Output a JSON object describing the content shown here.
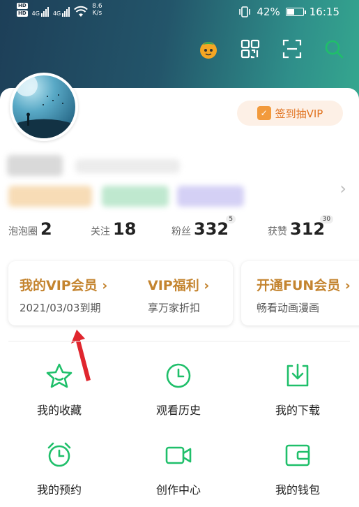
{
  "status_bar": {
    "hd1": "HD",
    "hd2": "HD",
    "sig1": "4G",
    "sig2": "4G",
    "speed": "8.6",
    "speed_unit": "K/s",
    "battery": "42%",
    "battery_level": 0.42,
    "time": "16:15"
  },
  "toolbar": {
    "icons": [
      "mascot-icon",
      "qr-code-icon",
      "scan-icon",
      "search-icon"
    ]
  },
  "profile": {
    "checkin_label": "签到抽VIP",
    "checkin_icon_glyph": "✓"
  },
  "stats": [
    {
      "label": "泡泡圈",
      "value": "2",
      "badge": ""
    },
    {
      "label": "关注",
      "value": "18",
      "badge": ""
    },
    {
      "label": "粉丝",
      "value": "332",
      "badge": "5"
    },
    {
      "label": "获赞",
      "value": "312",
      "badge": "30"
    }
  ],
  "vip": {
    "my_vip_title": "我的VIP会员 ›",
    "my_vip_sub": "2021/03/03到期",
    "welfare_title": "VIP福利 ›",
    "welfare_sub": "享万家折扣",
    "fun_title": "开通FUN会员 ›",
    "fun_sub": "畅看动画漫画"
  },
  "menu": [
    {
      "label": "我的收藏",
      "icon": "star-icon"
    },
    {
      "label": "观看历史",
      "icon": "clock-icon"
    },
    {
      "label": "我的下载",
      "icon": "download-icon"
    },
    {
      "label": "我的预约",
      "icon": "alarm-icon"
    },
    {
      "label": "创作中心",
      "icon": "video-camera-icon"
    },
    {
      "label": "我的钱包",
      "icon": "wallet-icon"
    }
  ],
  "colors": {
    "accent_green": "#1fbf6a",
    "vip_gold": "#c4842f",
    "checkin_orange": "#e1731f",
    "annotation_red": "#e0262e"
  }
}
